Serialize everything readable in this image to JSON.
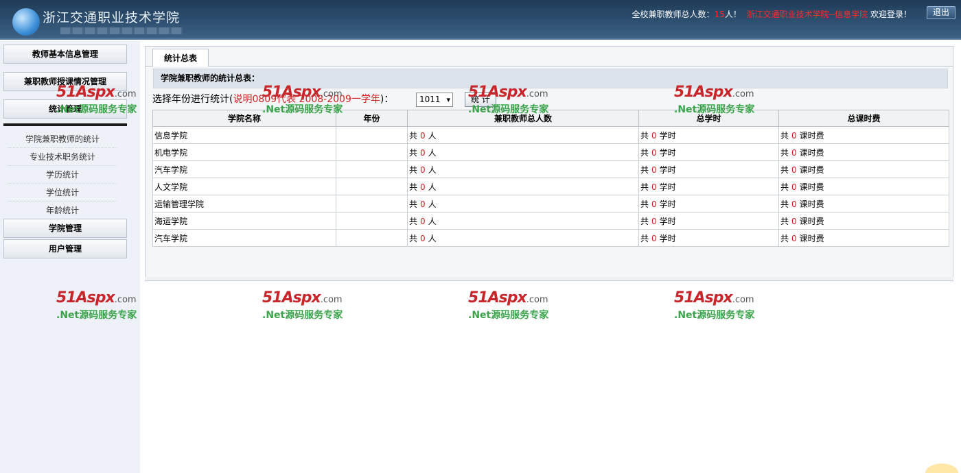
{
  "header": {
    "school_name": "浙江交通职业技术学院",
    "total_label": "全校兼职教师总人数：",
    "total_count": "15",
    "total_unit": "人！",
    "user_dept": "浙江交通职业技术学院--信息学院",
    "welcome": "欢迎登录！",
    "logout_label": "退出"
  },
  "sidebar": {
    "menu": [
      {
        "label": "教师基本信息管理"
      },
      {
        "label": "兼职教师授课情况管理"
      },
      {
        "label": "统计管理"
      },
      {
        "label": "学院管理"
      },
      {
        "label": "用户管理"
      }
    ],
    "sub_items": [
      {
        "label": "学院兼职教师的统计"
      },
      {
        "label": "专业技术职务统计"
      },
      {
        "label": "学历统计"
      },
      {
        "label": "学位统计"
      },
      {
        "label": "年龄统计"
      }
    ]
  },
  "main": {
    "tab_label": "统计总表",
    "section_title": "学院兼职教师的统计总表：",
    "filter_label": "选择年份进行统计(",
    "filter_note": "说明0809代表  2008-2009一学年",
    "filter_end": ")：",
    "year_selected": "1011",
    "stat_button": "统 计",
    "columns": [
      "学院名称",
      "年份",
      "兼职教师总人数",
      "总学时",
      "总课时费"
    ],
    "prefix": "共",
    "unit_people": "人",
    "unit_hours": "学时",
    "unit_fee": "课时费",
    "rows": [
      {
        "name": "信息学院",
        "year": "",
        "teachers": "0",
        "hours": "0",
        "fee": "0"
      },
      {
        "name": "机电学院",
        "year": "",
        "teachers": "0",
        "hours": "0",
        "fee": "0"
      },
      {
        "name": "汽车学院",
        "year": "",
        "teachers": "0",
        "hours": "0",
        "fee": "0"
      },
      {
        "name": "人文学院",
        "year": "",
        "teachers": "0",
        "hours": "0",
        "fee": "0"
      },
      {
        "name": "运输管理学院",
        "year": "",
        "teachers": "0",
        "hours": "0",
        "fee": "0"
      },
      {
        "name": "海运学院",
        "year": "",
        "teachers": "0",
        "hours": "0",
        "fee": "0"
      },
      {
        "name": "汽车学院",
        "year": "",
        "teachers": "0",
        "hours": "0",
        "fee": "0"
      }
    ]
  },
  "watermark": {
    "brand": "51Aspx",
    "domain": ".com",
    "slogan": ".Net源码服务专家"
  }
}
